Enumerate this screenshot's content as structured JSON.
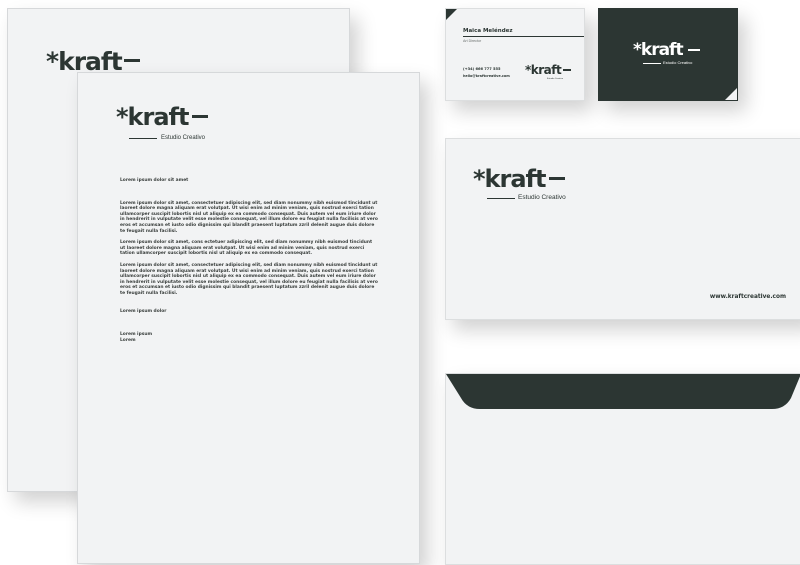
{
  "brand": {
    "logo_text": "*kraft",
    "tagline": "Estudio Creativo",
    "website": "www.kraftcreative.com",
    "colors": {
      "dark": "#2c3633",
      "paper": "#f2f3f4"
    }
  },
  "letterhead": {
    "heading": "Lorem ipsum dolor sit amet",
    "paragraphs": [
      "Lorem ipsum dolor sit amet, consectetuer adipiscing elit, sed diam nonummy nibh euismod tincidunt ut laoreet dolore magna aliquam erat volutpat. Ut wisi enim ad minim veniam, quis nostrud exerci tation ullamcorper suscipit lobortis nisl ut aliquip ex ea commodo consequat. Duis autem vel eum iriure dolor in hendrerit in vulputate velit esse molestie consequat, vel illum dolore eu feugiat nulla facilisis at vero eros et accumsan et iusto odio dignissim qui blandit praesent luptatum zzril delenit augue duis dolore te feugait nulla facilisi.",
      "Lorem ipsum dolor sit amet, cons ectetuer adipiscing elit, sed diam nonummy nibh euismod tincidunt ut laoreet dolore magna aliquam erat volutpat. Ut wisi enim ad minim veniam, quis nostrud exerci tation ullamcorper suscipit lobortis nisl ut aliquip ex ea commodo consequat.",
      "Lorem ipsum dolor sit amet, consectetuer adipiscing elit, sed diam nonummy nibh euismod tincidunt ut laoreet dolore magna aliquam erat volutpat. Ut wisi enim ad minim veniam, quis nostrud exerci tation ullamcorper suscipit lobortis nisl ut aliquip ex ea commodo consequat. Duis autem vel eum iriure dolor in hendrerit in vulputate velit esse molestie consequat, vel illum dolore eu feugiat nulla facilisis at vero eros et accumsan et iusto odio dignissim qui blandit praesent luptatum zzril delenit augue duis dolore te feugait nulla facilisi."
    ],
    "closing": "Lorem ipsum dolor",
    "signature_name": "Lorem ipsum",
    "signature_title": "Lorem"
  },
  "business_card": {
    "name": "Maica Meléndez",
    "title": "Art Director",
    "phone": "(+34) 666 777 555",
    "email": "hello@kraftcreative.com"
  }
}
